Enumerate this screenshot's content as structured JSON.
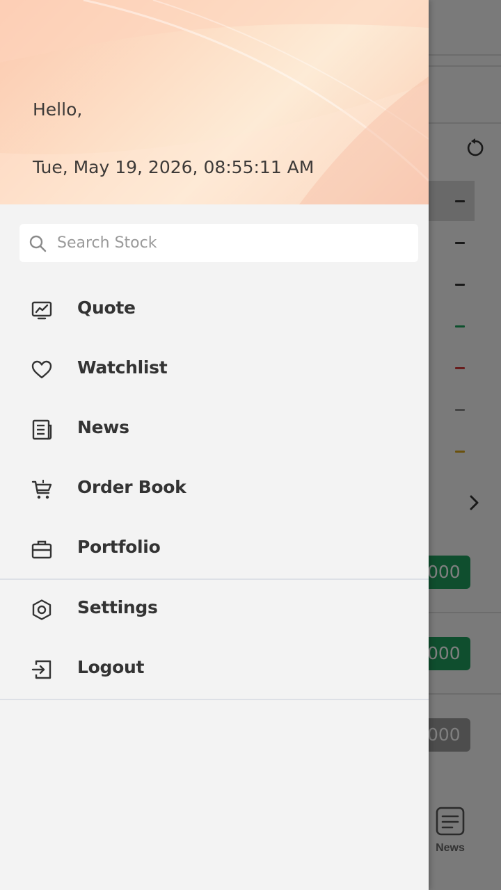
{
  "header": {
    "greeting": "Hello,",
    "datetime": "Tue, May 19, 2026, 08:55:11 AM"
  },
  "search": {
    "placeholder": "Search Stock"
  },
  "menu": {
    "items": [
      {
        "label": "Quote",
        "icon": "chart-icon"
      },
      {
        "label": "Watchlist",
        "icon": "heart-icon"
      },
      {
        "label": "News",
        "icon": "newspaper-icon"
      },
      {
        "label": "Order Book",
        "icon": "cart-icon"
      },
      {
        "label": "Portfolio",
        "icon": "briefcase-icon"
      }
    ],
    "secondary": [
      {
        "label": "Settings",
        "icon": "hexagon-gear-icon"
      },
      {
        "label": "Logout",
        "icon": "logout-icon"
      }
    ]
  },
  "background": {
    "pills": [
      "000",
      "000",
      "000"
    ],
    "bottom_nav_news": "News",
    "dash_colors": [
      "#333333",
      "#333333",
      "#333333",
      "#1aa05a",
      "#d03a3a",
      "#8a8a8a",
      "#d4a21a"
    ],
    "pill_colors": [
      "#1f9d5c",
      "#1f9d5c",
      "#9a9a9a"
    ]
  },
  "colors": {
    "drawer_bg": "#f3f3f3",
    "text": "#333333",
    "header_gradient_start": "#fcc9ae"
  }
}
